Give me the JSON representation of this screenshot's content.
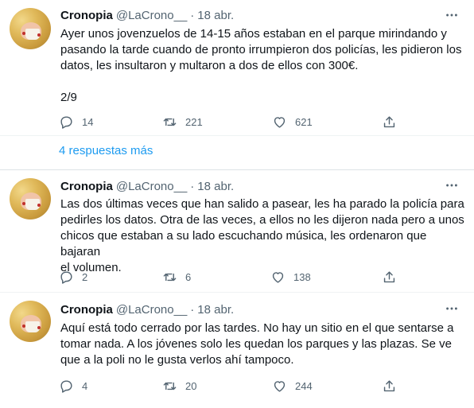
{
  "tweets": [
    {
      "name": "Cronopia",
      "handle": "@LaCrono__",
      "dot": "·",
      "date": "18 abr.",
      "text": "Ayer unos jovenzuelos de 14-15 años estaban en el parque mirindando y\npasando la tarde cuando de pronto irrumpieron dos policías, les pidieron los\ndatos, les insultaron y multaron a dos de ellos con 300€.\n\n2/9",
      "replies": "14",
      "retweets": "221",
      "likes": "621"
    },
    {
      "name": "Cronopia",
      "handle": "@LaCrono__",
      "dot": "·",
      "date": "18 abr.",
      "text": "Las dos últimas veces que han salido a pasear, les ha parado la policía para\npedirles los datos. Otra de las veces, a ellos no les dijeron nada pero a unos\nchicos que estaban a su lado escuchando música, les ordenaron que bajaran\nel volumen.",
      "replies": "2",
      "retweets": "6",
      "likes": "138"
    },
    {
      "name": "Cronopia",
      "handle": "@LaCrono__",
      "dot": "·",
      "date": "18 abr.",
      "text": "Aquí está todo cerrado por las tardes. No hay un sitio en el que sentarse a\ntomar nada. A los jóvenes solo les quedan los parques y las plazas. Se ve\nque a la poli no le gusta verlos ahí tampoco.",
      "replies": "4",
      "retweets": "20",
      "likes": "244"
    }
  ],
  "more_replies_label": "4 respuestas más",
  "colors": {
    "link": "#1d9bf0",
    "muted": "#536471",
    "text": "#0f1419"
  },
  "icons": [
    "more-icon",
    "reply-icon",
    "retweet-icon",
    "like-icon",
    "share-icon"
  ]
}
